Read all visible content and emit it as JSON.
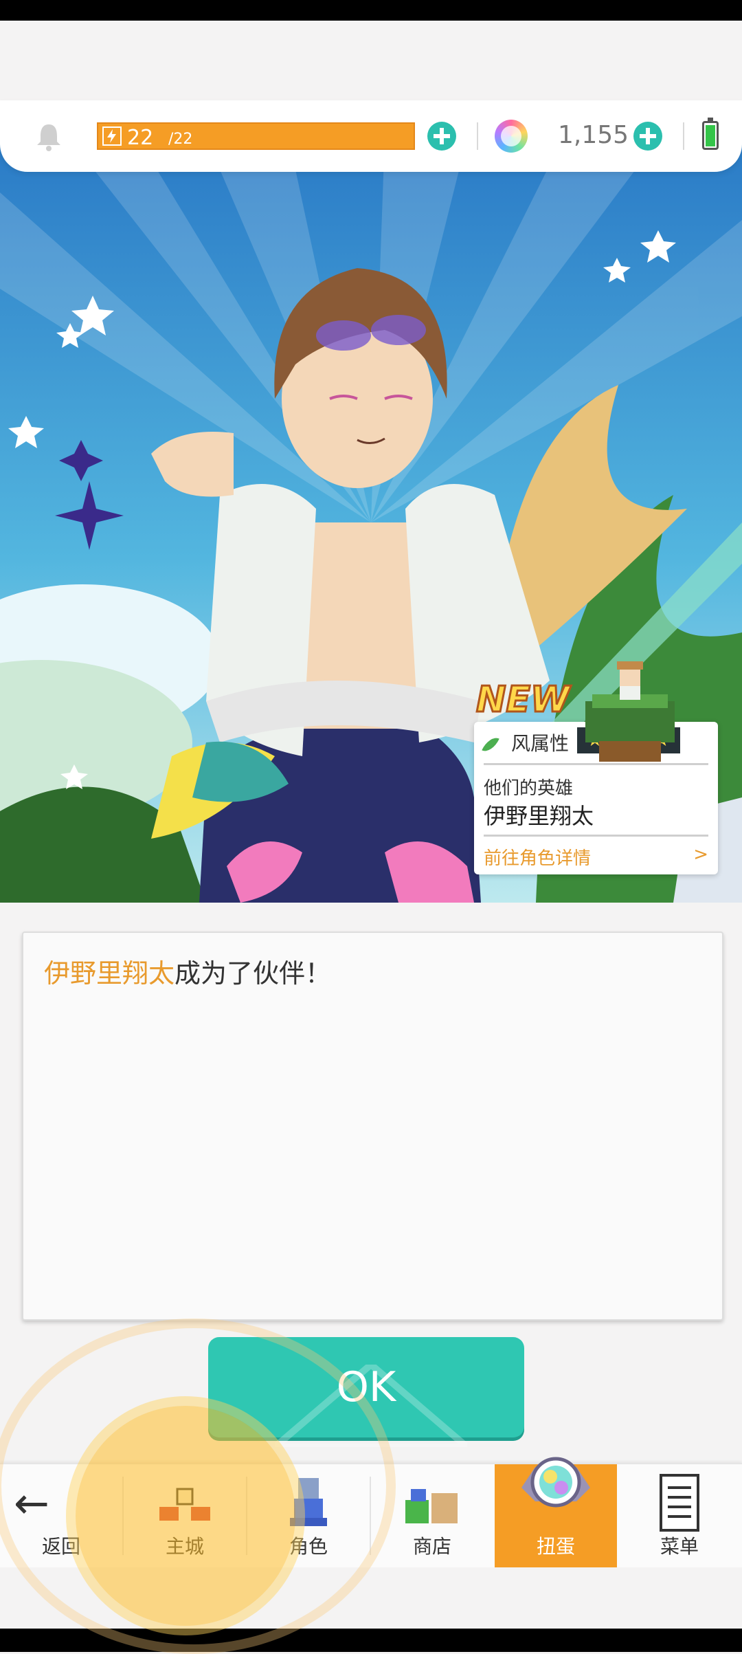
{
  "resources": {
    "stamina_current": "22",
    "stamina_max": "/22",
    "gem_count": "1,155"
  },
  "hero_card": {
    "badge": "NEW",
    "element": "风属性",
    "stars": "★★★★★",
    "subtitle": "他们的英雄",
    "name": "伊野里翔太",
    "detail_link": "前往角色详情",
    "detail_arrow": ">"
  },
  "message": {
    "highlight": "伊野里翔太",
    "text": "成为了伙伴！"
  },
  "ok_button": "OK",
  "nav": {
    "back": "返回",
    "main_city": "主城",
    "characters": "角色",
    "shop": "商店",
    "gacha": "扭蛋",
    "menu": "菜单"
  },
  "colors": {
    "accent_orange": "#f59d25",
    "accent_teal": "#2fc7b2",
    "highlight_text": "#e89a2d"
  },
  "icons": [
    "bell-icon",
    "lightning-icon",
    "add-icon",
    "rainbow-gem-icon",
    "battery-icon",
    "wind-leaf-icon",
    "back-arrow-icon",
    "castle-icon",
    "character-icon",
    "shop-icon",
    "gacha-capsule-icon",
    "menu-list-icon"
  ]
}
